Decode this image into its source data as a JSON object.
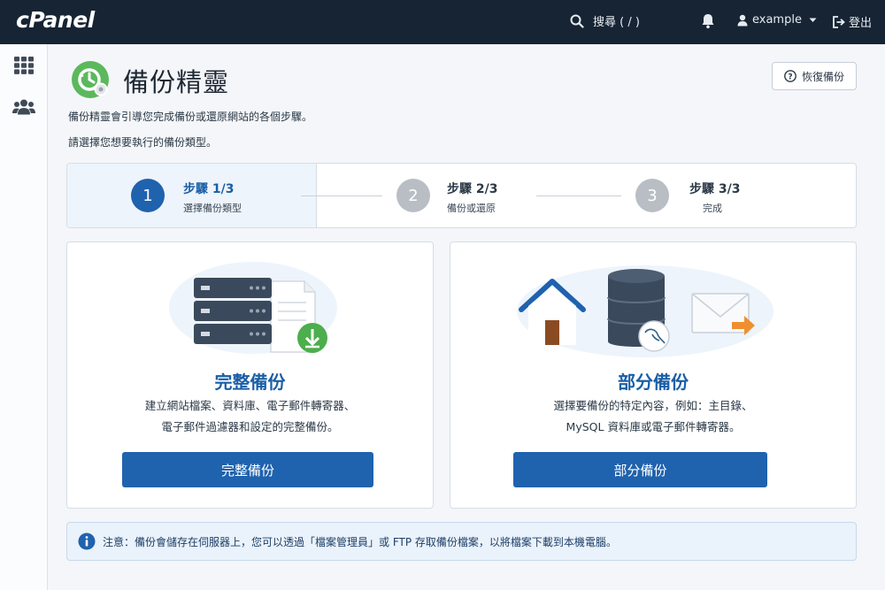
{
  "topbar": {
    "logo": "cPanel",
    "search_label": "搜尋 ( / )",
    "user_name": "example",
    "logout_label": "登出"
  },
  "header": {
    "title": "備份精靈",
    "restore_button": "恢復備份",
    "intro_line1": "備份精靈會引導您完成備份或還原網站的各個步驟。",
    "intro_line2": "請選擇您想要執行的備份類型。"
  },
  "steps": [
    {
      "number": "1",
      "title": "步驟 1/3",
      "subtitle": "選擇備份類型",
      "active": true
    },
    {
      "number": "2",
      "title": "步驟 2/3",
      "subtitle": "備份或還原",
      "active": false
    },
    {
      "number": "3",
      "title": "步驟 3/3",
      "subtitle": "完成",
      "active": false
    }
  ],
  "cards": {
    "full": {
      "title": "完整備份",
      "desc_line1": "建立網站檔案、資料庫、電子郵件轉寄器、",
      "desc_line2": "電子郵件過濾器和設定的完整備份。",
      "button": "完整備份"
    },
    "partial": {
      "title": "部分備份",
      "desc_line1": "選擇要備份的特定內容，例如：主目錄、",
      "desc_line2": "MySQL 資料庫或電子郵件轉寄器。",
      "button": "部分備份"
    }
  },
  "notice": {
    "text": "注意：備份會儲存在伺服器上，您可以透過「檔案管理員」或 FTP 存取備份檔案，以將檔案下載到本機電腦。"
  },
  "colors": {
    "topbar": "#172433",
    "accent_blue": "#1f62ae",
    "step_active": "#1f62ae",
    "step_inactive": "#b9bec5",
    "logo_green": "#5cb85c"
  },
  "icons": [
    "search-icon",
    "bell-icon",
    "user-icon",
    "chevron-down-icon",
    "logout-icon",
    "grid-icon",
    "users-icon",
    "backup-wizard-icon",
    "question-icon",
    "info-icon"
  ]
}
